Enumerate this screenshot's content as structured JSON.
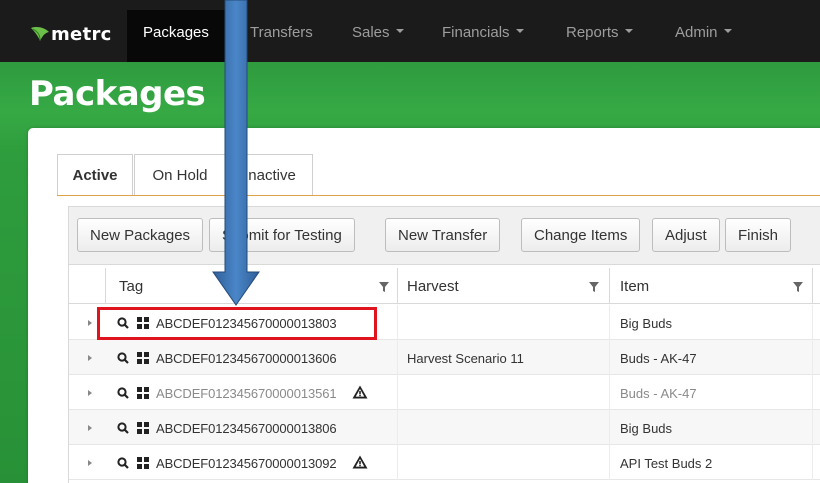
{
  "navbar": {
    "logo": "metrc",
    "items": [
      {
        "label": "Packages",
        "has_caret": false,
        "active": true
      },
      {
        "label": "Transfers",
        "has_caret": false,
        "active": false
      },
      {
        "label": "Sales",
        "has_caret": true,
        "active": false
      },
      {
        "label": "Financials",
        "has_caret": true,
        "active": false
      },
      {
        "label": "Reports",
        "has_caret": true,
        "active": false
      },
      {
        "label": "Admin",
        "has_caret": true,
        "active": false
      }
    ]
  },
  "page": {
    "title": "Packages"
  },
  "tabs": [
    {
      "label": "Active",
      "selected": true
    },
    {
      "label": "On Hold",
      "selected": false
    },
    {
      "label": "Inactive",
      "selected": false
    }
  ],
  "toolbar": {
    "buttons": [
      "New Packages",
      "Submit for Testing",
      "New Transfer",
      "Change Items",
      "Adjust",
      "Finish"
    ]
  },
  "table": {
    "columns": [
      "Tag",
      "Harvest",
      "Item"
    ],
    "rows": [
      {
        "tag": "ABCDEF012345670000013803",
        "warning": false,
        "harvest": "",
        "item": "Big Buds",
        "muted": false,
        "highlighted": true
      },
      {
        "tag": "ABCDEF012345670000013606",
        "warning": false,
        "harvest": "Harvest Scenario 11",
        "item": "Buds - AK-47",
        "muted": false,
        "highlighted": false
      },
      {
        "tag": "ABCDEF012345670000013561",
        "warning": true,
        "harvest": "",
        "item": "Buds - AK-47",
        "muted": true,
        "highlighted": false
      },
      {
        "tag": "ABCDEF012345670000013806",
        "warning": false,
        "harvest": "",
        "item": "Big Buds",
        "muted": false,
        "highlighted": false
      },
      {
        "tag": "ABCDEF012345670000013092",
        "warning": true,
        "harvest": "",
        "item": "API Test Buds 2",
        "muted": false,
        "highlighted": false
      }
    ]
  },
  "colors": {
    "navbar": "#1b1b1b",
    "hero_green": "#2e9b3f",
    "highlight_border": "#e0141e",
    "arrow_blue": "#3a74b6",
    "tab_accent": "#e0a34a"
  },
  "icons": {
    "logo": "leaf-icon",
    "row_search": "magnifier-icon",
    "row_barcode": "grid-icon",
    "warning": "warning-triangle-icon",
    "filter": "filter-funnel-icon",
    "expander": "caret-right-icon",
    "annotation": "down-arrow-icon"
  }
}
